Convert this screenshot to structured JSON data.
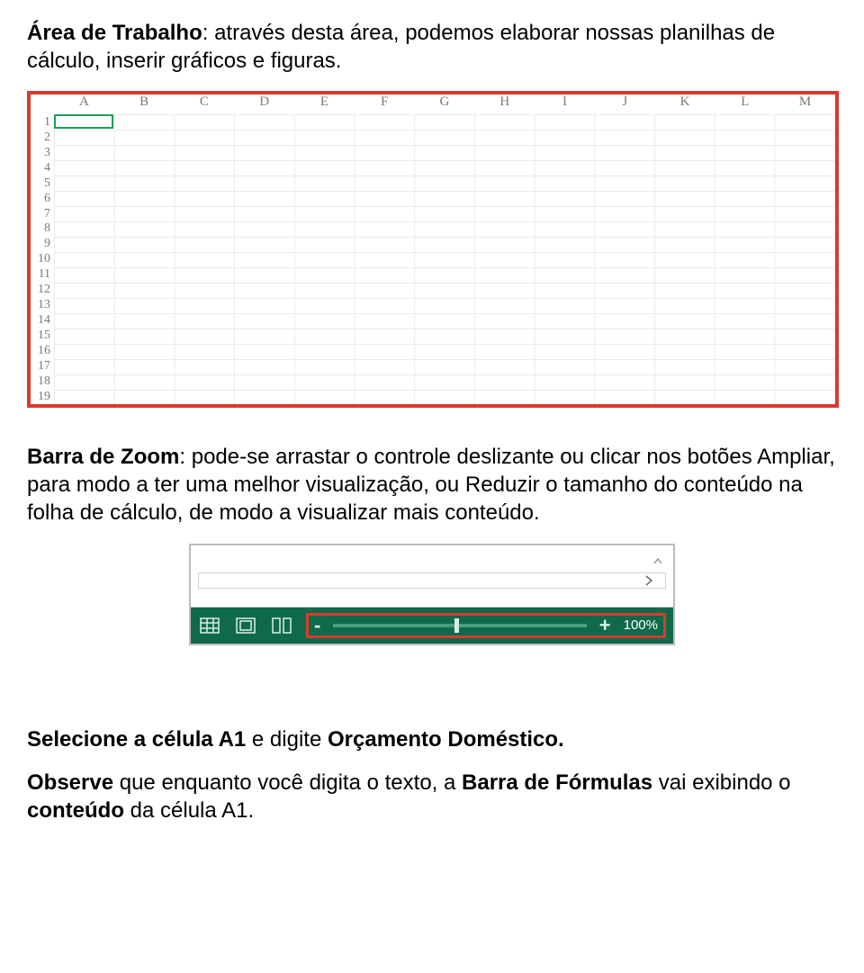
{
  "p1": {
    "title": "Área de Trabalho",
    "sep": ": ",
    "body": "através desta área, podemos elaborar nossas planilhas de cálculo, inserir gráficos e figuras."
  },
  "sheet": {
    "cols": [
      "A",
      "B",
      "C",
      "D",
      "E",
      "F",
      "G",
      "H",
      "I",
      "J",
      "K",
      "L",
      "M"
    ],
    "rows": [
      "1",
      "2",
      "3",
      "4",
      "5",
      "6",
      "7",
      "8",
      "9",
      "10",
      "11",
      "12",
      "13",
      "14",
      "15",
      "16",
      "17",
      "18",
      "19"
    ]
  },
  "p2": {
    "title": "Barra de Zoom",
    "sep": ": ",
    "body": "pode-se arrastar o controle deslizante ou clicar nos botões Ampliar, para modo a ter uma melhor visualização, ou Reduzir o tamanho do conteúdo na folha de cálculo, de modo a visualizar mais conteúdo."
  },
  "zoom": {
    "minus": "-",
    "plus": "+",
    "pct": "100%"
  },
  "p3": {
    "pre": "Selecione a célula ",
    "b1": "A1",
    "mid": " e digite ",
    "b2": "Orçamento Doméstico."
  },
  "p4": {
    "pre": "Observe",
    "mid1": " que enquanto você digita o texto, a ",
    "b2": "Barra de Fórmulas",
    "mid2": " vai exibindo o ",
    "b3": "conteúdo",
    "tail": " da célula A1."
  }
}
